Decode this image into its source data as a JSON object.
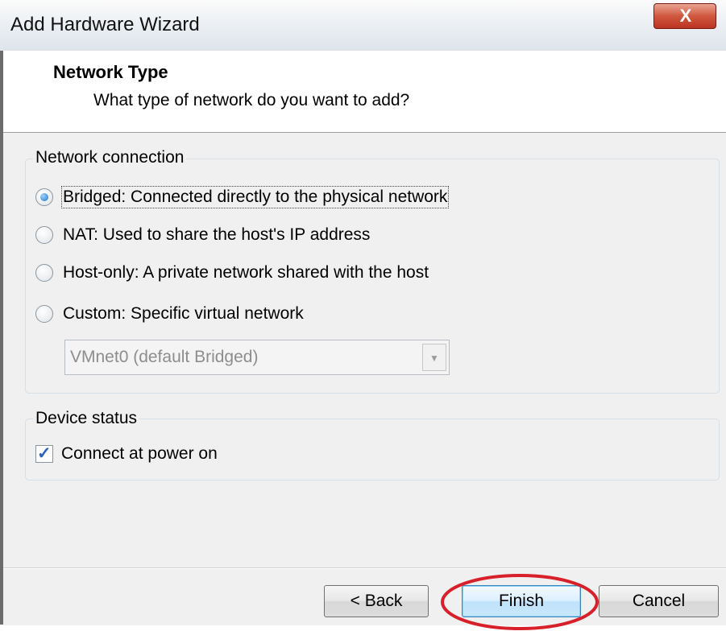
{
  "window": {
    "title": "Add Hardware Wizard",
    "close_glyph": "X",
    "close_icon": "close-icon"
  },
  "header": {
    "title": "Network Type",
    "subtitle": "What type of network do you want to add?"
  },
  "network_connection": {
    "group_title": "Network connection",
    "options": [
      {
        "label": "Bridged: Connected directly to the physical network",
        "selected": true
      },
      {
        "label": "NAT: Used to share the host's IP address",
        "selected": false
      },
      {
        "label": "Host-only: A private network shared with the host",
        "selected": false
      },
      {
        "label": "Custom: Specific virtual network",
        "selected": false
      }
    ],
    "custom_network": {
      "value": "VMnet0 (default Bridged)",
      "enabled": false,
      "arrow_icon": "chevron-down-icon"
    }
  },
  "device_status": {
    "group_title": "Device status",
    "connect_at_power_on": {
      "label": "Connect at power on",
      "checked": true,
      "check_glyph": "✓"
    }
  },
  "buttons": {
    "back": "< Back",
    "finish": "Finish",
    "cancel": "Cancel"
  },
  "colors": {
    "accent": "#1f6fc4",
    "close_red": "#c9432f",
    "annotation_red": "#d8202a",
    "dialog_bg": "#f0f0f0"
  }
}
